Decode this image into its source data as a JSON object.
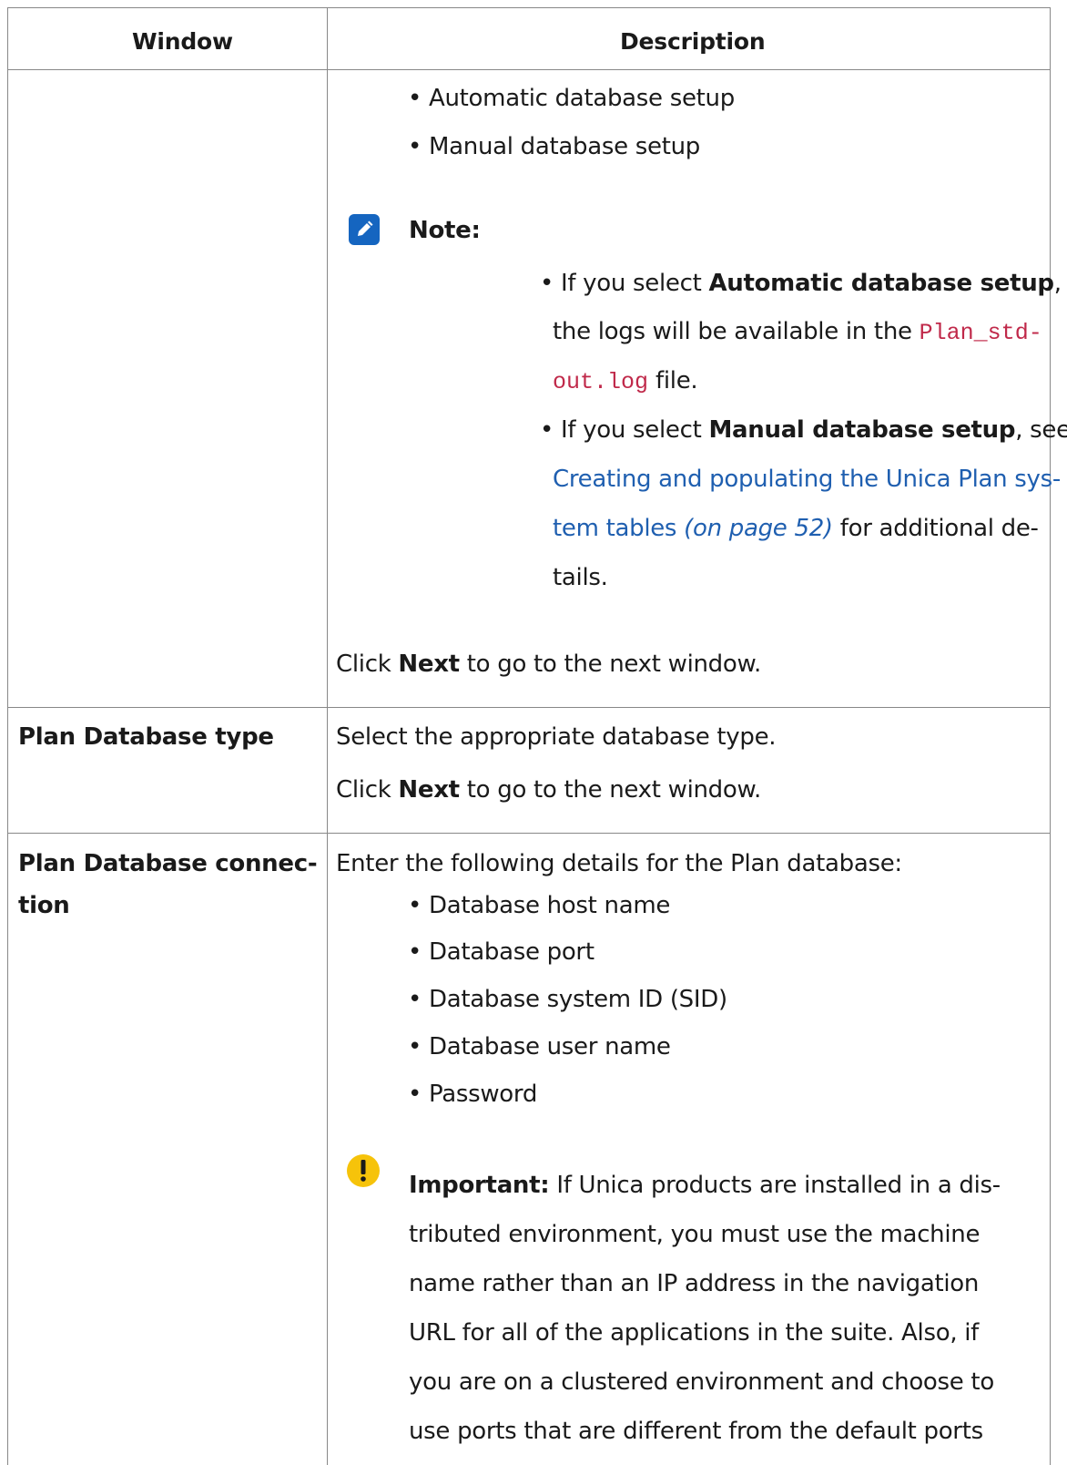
{
  "table": {
    "headers": {
      "window": "Window",
      "description": "Description"
    },
    "row1": {
      "bullets": [
        "• Automatic database setup",
        "• Manual database setup"
      ],
      "note": {
        "title": "Note:",
        "item1": {
          "lead": "• If you select ",
          "bold": "Automatic database setup",
          "after": ",",
          "line2_text": "the logs will be available in the ",
          "code_part1": "Plan_std-",
          "code_part2": "out.log",
          "line3_after": " file."
        },
        "item2": {
          "lead": "• If you select ",
          "bold": "Manual database setup",
          "after": ", see",
          "link_line1": "Creating and populating the Unica Plan sys-",
          "link_line2": "tem tables",
          "page_ref": " (on page 52)",
          "line3_after": " for additional de-",
          "line4": "tails."
        }
      },
      "click_next": {
        "pre": "Click ",
        "bold": "Next",
        "post": " to go to the next window."
      }
    },
    "row2": {
      "window": "Plan Database type",
      "line1": "Select the appropriate database type.",
      "click_next": {
        "pre": "Click ",
        "bold": "Next",
        "post": " to go to the next window."
      }
    },
    "row3": {
      "window_line1": "Plan Database connec-",
      "window_line2": "tion",
      "intro": "Enter the following details for the Plan database:",
      "bullets": [
        "• Database host name",
        "• Database port",
        "• Database system ID (SID)",
        "• Database user name",
        "• Password"
      ],
      "important": {
        "label": "Important:",
        "line1": " If Unica products are installed in a dis-",
        "lines": [
          "tributed environment, you must use the machine",
          "name rather than an IP address in the navigation",
          "URL for all of the applications in the suite. Also, if",
          "you are on a clustered environment and choose to",
          "use ports that are different from the default ports"
        ]
      }
    }
  },
  "colors": {
    "link": "#1f5fb0",
    "code": "#c0294a",
    "note_icon": "#1565c0",
    "important_icon": "#f6c30a"
  },
  "icons": {
    "note": "pencil-note-icon",
    "important": "exclamation-icon"
  }
}
